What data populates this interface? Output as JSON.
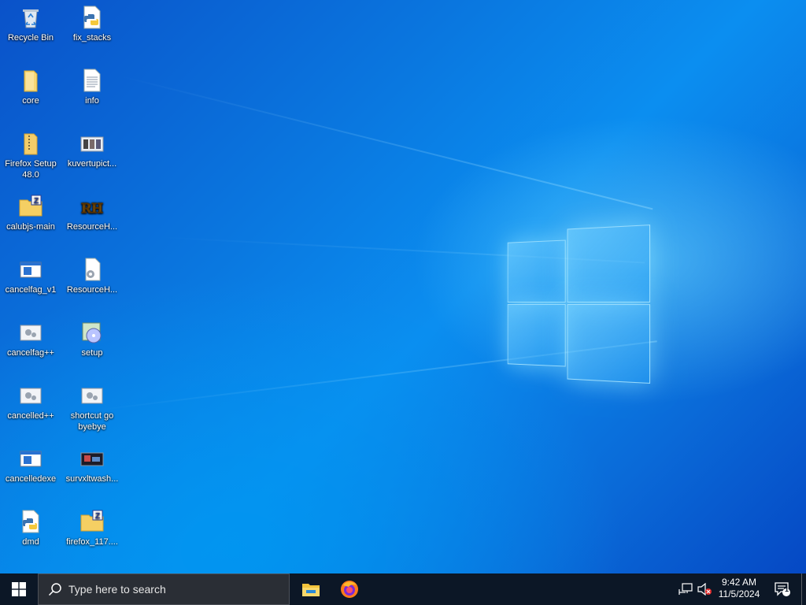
{
  "desktop": {
    "icons": [
      {
        "label": "Recycle Bin",
        "icon": "recycle-bin-icon"
      },
      {
        "label": "fix_stacks",
        "icon": "python-file-icon"
      },
      {
        "label": "core",
        "icon": "folder-icon"
      },
      {
        "label": "info",
        "icon": "text-document-icon"
      },
      {
        "label": "Firefox Setup 48.0",
        "icon": "zip-folder-icon"
      },
      {
        "label": "kuvertupict...",
        "icon": "image-file-icon"
      },
      {
        "label": "calubjs-main",
        "icon": "zip-archive-icon"
      },
      {
        "label": "ResourceH...",
        "icon": "resource-hacker-icon"
      },
      {
        "label": "cancelfag_v1",
        "icon": "window-app-icon"
      },
      {
        "label": "ResourceH...",
        "icon": "settings-file-icon"
      },
      {
        "label": "cancelfag++",
        "icon": "gear-app-icon"
      },
      {
        "label": "setup",
        "icon": "setup-installer-icon"
      },
      {
        "label": "cancelled++",
        "icon": "gear-app-icon"
      },
      {
        "label": "shortcut go byebye",
        "icon": "gear-app-icon"
      },
      {
        "label": "cancelledexe",
        "icon": "window-app-icon"
      },
      {
        "label": "survxltwash...",
        "icon": "image-file-icon"
      },
      {
        "label": "dmd",
        "icon": "python-file-icon"
      },
      {
        "label": "firefox_117....",
        "icon": "zip-archive-icon"
      }
    ]
  },
  "taskbar": {
    "start_icon": "windows-logo-icon",
    "search_placeholder": "Type here to search",
    "pinned": [
      {
        "name": "File Explorer",
        "icon": "file-explorer-icon"
      },
      {
        "name": "Firefox",
        "icon": "firefox-icon"
      }
    ],
    "tray": {
      "network_icon": "network-icon",
      "volume_icon": "volume-muted-icon",
      "time": "9:42 AM",
      "date": "11/5/2024",
      "notification_count": "1"
    }
  },
  "colors": {
    "taskbar": "#0c1726",
    "desktop_blue": "#0a78e0"
  }
}
